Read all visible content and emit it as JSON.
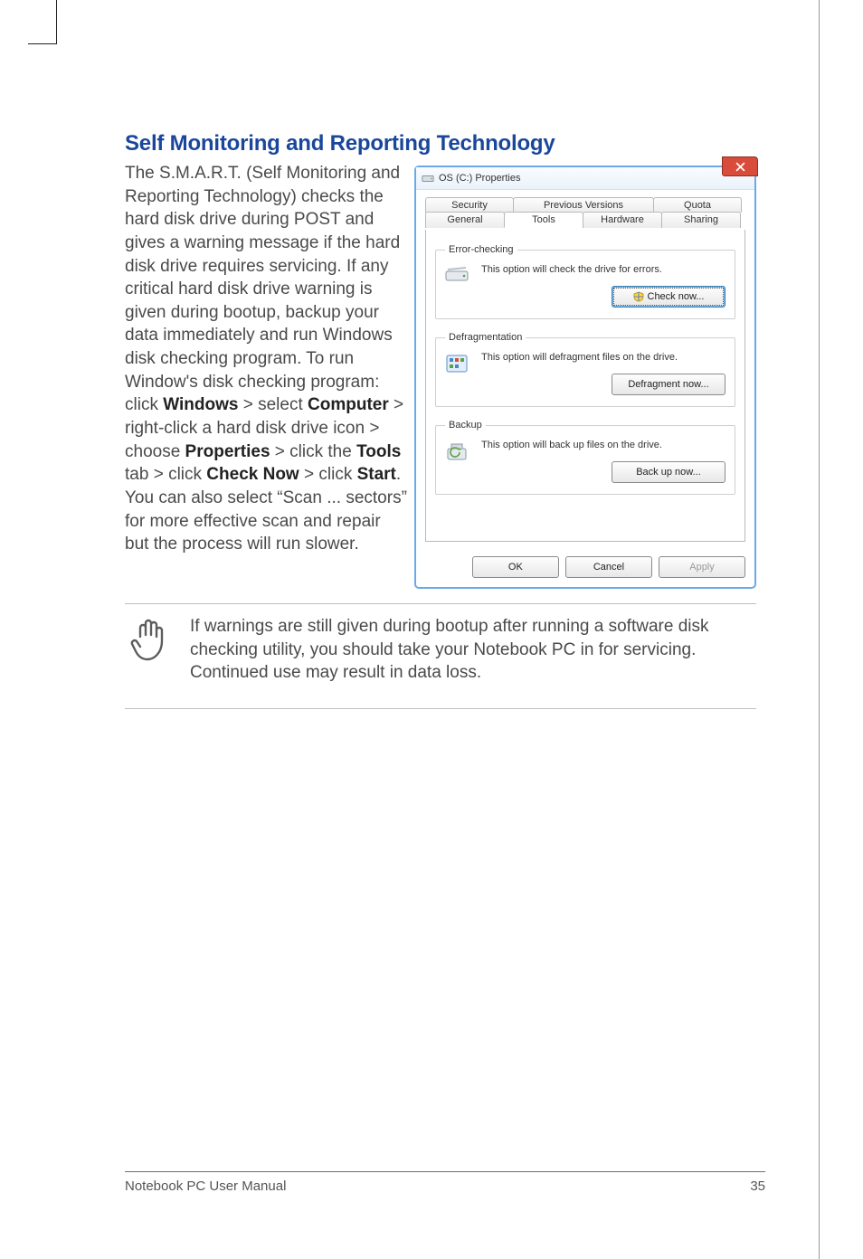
{
  "heading": "Self Monitoring and Reporting Technology",
  "body_pre": "The S.M.A.R.T. (Self Monitoring and Reporting Technology) checks the hard disk drive during POST and gives a warning message if the hard disk drive requires servicing. If any critical hard disk drive warning is given during bootup, backup your data immediately and run Windows disk checking program. To run Window's disk checking program: click ",
  "b1": "Windows",
  "body_mid1": " > select ",
  "b2": "Computer",
  "body_mid2": " > right-click a hard disk drive icon > choose ",
  "b3": "Properties",
  "body_mid3": " > click the ",
  "b4": "Tools",
  "body_mid4": " tab > click ",
  "b5": "Check Now",
  "body_mid5": " > click ",
  "b6": "Start",
  "body_post": ". You can also select “Scan ... sectors” for more effective scan and repair but the process will run slower.",
  "note": "If warnings are still given during bootup after running a software disk checking utility, you should take your Notebook PC in for servicing. Continued use may result in data loss.",
  "dialog": {
    "title": "OS (C:) Properties",
    "tabs_back": [
      "Security",
      "Previous Versions",
      "Quota"
    ],
    "tabs_front": [
      "General",
      "Tools",
      "Hardware",
      "Sharing"
    ],
    "groups": {
      "error": {
        "legend": "Error-checking",
        "text": "This option will check the drive for errors.",
        "button": "Check now..."
      },
      "defrag": {
        "legend": "Defragmentation",
        "text": "This option will defragment files on the drive.",
        "button": "Defragment now..."
      },
      "backup": {
        "legend": "Backup",
        "text": "This option will back up files on the drive.",
        "button": "Back up now..."
      }
    },
    "buttons": {
      "ok": "OK",
      "cancel": "Cancel",
      "apply": "Apply"
    }
  },
  "footer": {
    "left": "Notebook PC User Manual",
    "right": "35"
  }
}
